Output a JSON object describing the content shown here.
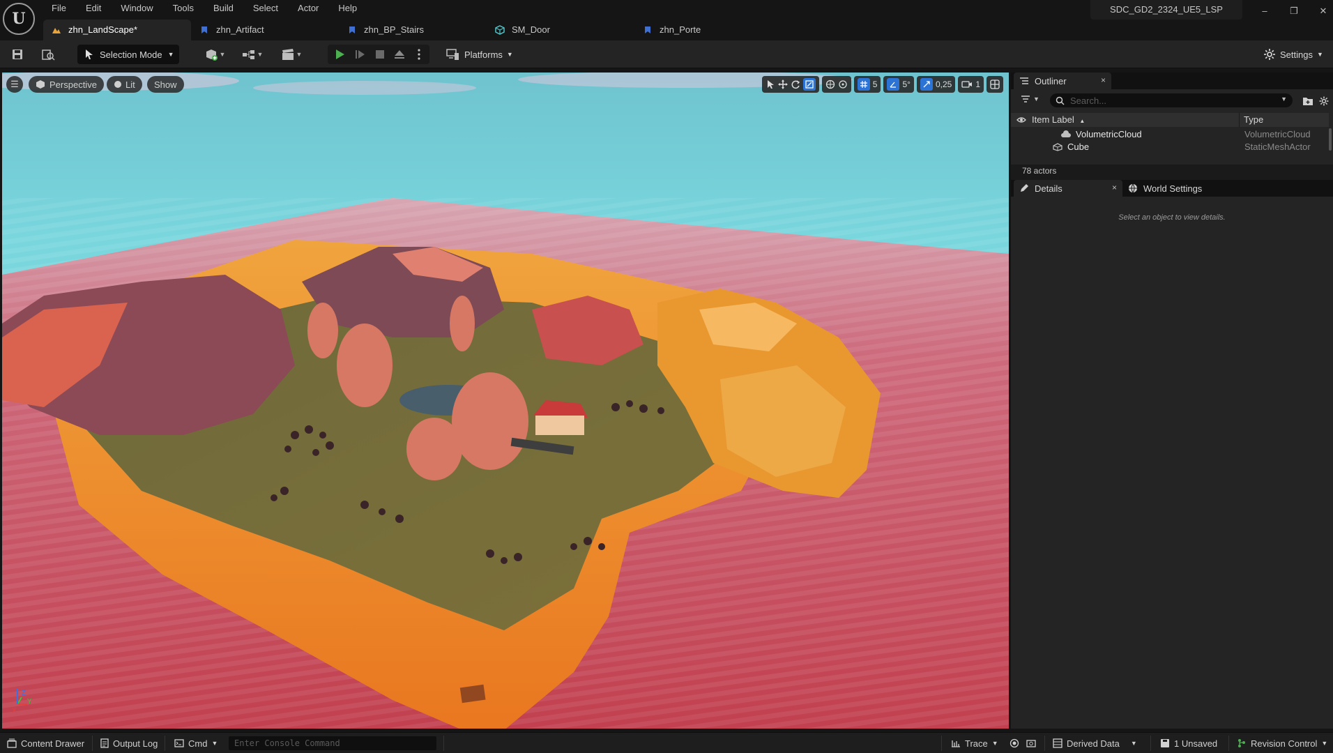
{
  "app": {
    "project_name": "SDC_GD2_2324_UE5_LSP",
    "logo_text": "U",
    "menu": [
      "File",
      "Edit",
      "Window",
      "Tools",
      "Build",
      "Select",
      "Actor",
      "Help"
    ],
    "window_controls": {
      "minimize": "–",
      "maximize": "❐",
      "close": "✕"
    }
  },
  "tabs": [
    {
      "label": "zhn_LandScape*",
      "icon": "level-icon",
      "active": true
    },
    {
      "label": "zhn_Artifact",
      "icon": "blueprint-icon",
      "active": false
    },
    {
      "label": "zhn_BP_Stairs",
      "icon": "blueprint-icon",
      "active": false
    },
    {
      "label": "SM_Door",
      "icon": "static-mesh-icon",
      "active": false
    },
    {
      "label": "zhn_Porte",
      "icon": "blueprint-icon",
      "active": false
    }
  ],
  "toolbar": {
    "selection_mode": "Selection Mode",
    "platforms": "Platforms",
    "settings": "Settings"
  },
  "viewport": {
    "hamburger": "☰",
    "perspective": "Perspective",
    "lit": "Lit",
    "show": "Show",
    "grid_snap": "5",
    "rotation_snap": "5°",
    "scale_snap": "0,25",
    "camera_speed": "1",
    "axis_labels": {
      "z": "Z",
      "y": "Y",
      "x": "X"
    }
  },
  "outliner": {
    "tab_label": "Outliner",
    "close": "×",
    "search_placeholder": "Search...",
    "col_label": "Item Label",
    "col_label_sort": "▲",
    "col_type": "Type",
    "rows": [
      {
        "name": "VolumetricCloud",
        "type": "VolumetricCloud"
      },
      {
        "name": "Cube",
        "type": "StaticMeshActor"
      }
    ],
    "actor_count": "78 actors"
  },
  "details": {
    "tab_label": "Details",
    "close": "×",
    "world_settings_label": "World Settings",
    "hint": "Select an object to view details."
  },
  "statusbar": {
    "content_drawer": "Content Drawer",
    "output_log": "Output Log",
    "cmd": "Cmd",
    "console_placeholder": "Enter Console Command",
    "trace": "Trace",
    "derived_data": "Derived Data",
    "unsaved": "1 Unsaved",
    "revision_control": "Revision Control"
  },
  "colors": {
    "accent_blue": "#2b74d6",
    "play_green": "#4caf50",
    "sky": "#6ad0d8",
    "water": "#c7455a",
    "rock_orange": "#e9902e"
  }
}
